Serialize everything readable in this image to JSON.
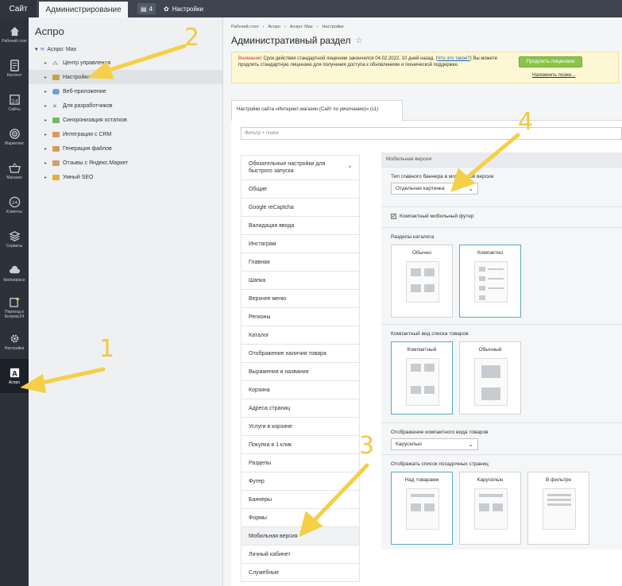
{
  "topbar": {
    "site": "Сайт",
    "admin": "Администрирование",
    "badge": "4",
    "settings": "Настройки"
  },
  "nav": [
    {
      "label": "Рабочий стол",
      "icon": "home-icon"
    },
    {
      "label": "Контент",
      "icon": "document-icon"
    },
    {
      "label": "Сайты",
      "icon": "calendar-24-icon"
    },
    {
      "label": "Маркетинг",
      "icon": "target-icon"
    },
    {
      "label": "Магазин",
      "icon": "basket-icon"
    },
    {
      "label": "Клиенты",
      "icon": "clients-24-icon"
    },
    {
      "label": "Сервисы",
      "icon": "layers-icon"
    },
    {
      "label": "Marketplace",
      "icon": "cloud-icon"
    },
    {
      "label": "Переход в Битрикс24",
      "icon": "sparkle-icon"
    },
    {
      "label": "Настройки",
      "icon": "gear-icon"
    },
    {
      "label": "Аспро",
      "icon": "aspro-a-icon"
    }
  ],
  "tree": {
    "title": "Аспро",
    "root": "Аспро: Max",
    "items": [
      "Центр управления",
      "Настройки",
      "Веб-приложение",
      "Для разработчиков",
      "Синхронизация остатков",
      "Интеграция с CRM",
      "Генерация файлов",
      "Отзывы с Яндекс.Маркет",
      "Умный SEO"
    ]
  },
  "breadcrumbs": [
    "Рабочий стол",
    "Аспро",
    "Аспро: Max",
    "Настройки"
  ],
  "page_title": "Административный раздел",
  "warning": {
    "prefix": "Внимание!",
    "text": " Срок действия стандартной лицензии закончился 04.02.2022, 10 дней назад. (",
    "link": "Что это такое?",
    "text2": ") Вы можете продлить стандартную лицензию для получения доступа к обновлениям и технической поддержке.",
    "renew": "Продлить лицензию",
    "remind": "Напомнить позже..."
  },
  "tab": "Настройки сайта «Интернет-магазин (Сайт по умолчанию)» (s1)",
  "filter_placeholder": "Фильтр + поиск",
  "menu": [
    "Обязательные настройки для быстрого запуска",
    "Общие",
    "Google reCaptcha",
    "Валидация ввода",
    "Инстаграм",
    "Главная",
    "Шапка",
    "Верхнее меню",
    "Регионы",
    "Каталог",
    "Отображение наличия товара",
    "Выражения и названия",
    "Корзина",
    "Адреса страниц",
    "Услуги в корзине",
    "Покупка в 1 клик",
    "Разделы",
    "Футер",
    "Баннеры",
    "Формы",
    "Мобильная версия",
    "Личный кабинет",
    "Служебные"
  ],
  "mobile": {
    "section": "Мобильная версия",
    "banner_label": "Тип главного баннера в мобильной версии",
    "banner_value": "Отдельная картинка",
    "footer_label": "Компактный мобильный футер",
    "catalog_label": "Разделы каталога",
    "catalog_opts": [
      "Обычно",
      "Компактно"
    ],
    "list_label": "Компактный вид списка товаров",
    "list_opts": [
      "Компактный",
      "Обычный"
    ],
    "display_label": "Отображение компактного вида товаров",
    "display_value": "Каруселью",
    "landing_label": "Отображать список посадочных страниц",
    "landing_opts": [
      "Над товарами",
      "Каруселью",
      "В фильтре"
    ]
  },
  "annotations": [
    "1",
    "2",
    "3",
    "4"
  ]
}
